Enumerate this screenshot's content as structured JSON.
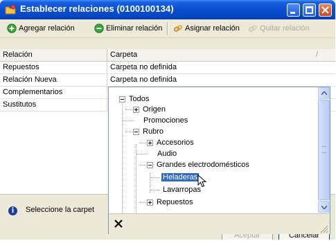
{
  "window": {
    "title": "Establecer relaciones (0100100134)"
  },
  "toolbar": {
    "add_label": "Agregar relación",
    "remove_label": "Eliminar relación",
    "assign_label": "Asignar relación",
    "clear_label": "Quitar relación"
  },
  "grid": {
    "columns": [
      "Relación",
      "Carpeta"
    ],
    "sort_indicator": "/",
    "rows": [
      {
        "relacion": "Repuestos",
        "carpeta": "Carpeta no definida"
      },
      {
        "relacion": "Relación Nueva",
        "carpeta": "Carpeta no definida"
      },
      {
        "relacion": "Complementarios",
        "carpeta": ""
      },
      {
        "relacion": "Sustitutos",
        "carpeta": ""
      }
    ]
  },
  "tree": {
    "nodes": [
      {
        "label": "Todos",
        "expanded": true
      },
      {
        "label": "Origen",
        "expanded": false
      },
      {
        "label": "Promociones"
      },
      {
        "label": "Rubro",
        "expanded": true
      },
      {
        "label": "Accesorios",
        "expanded": false
      },
      {
        "label": "Audio"
      },
      {
        "label": "Grandes electrodomésticos",
        "expanded": true
      },
      {
        "label": "Heladeras",
        "selected": true
      },
      {
        "label": "Lavarropas"
      },
      {
        "label": "Repuestos",
        "expanded": false
      }
    ]
  },
  "status": {
    "message": "Seleccione la carpet"
  },
  "buttons": {
    "ok_label": "Aceptar",
    "cancel_label": "Cancelar"
  },
  "colors": {
    "titlebar": "#0a4fd0",
    "selection": "#316ac5"
  }
}
